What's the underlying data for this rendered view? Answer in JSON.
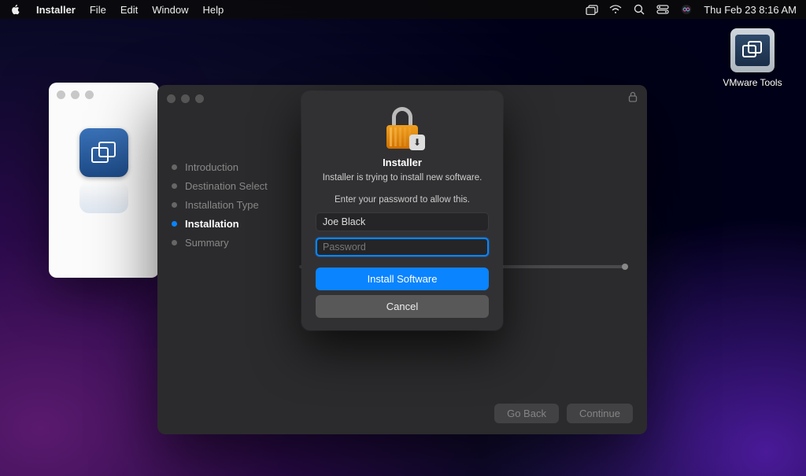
{
  "menubar": {
    "app": "Installer",
    "items": [
      "File",
      "Edit",
      "Window",
      "Help"
    ],
    "clock": "Thu Feb 23  8:16 AM"
  },
  "desktop": {
    "vmware_tools_label": "VMware Tools"
  },
  "installer": {
    "steps": {
      "introduction": "Introduction",
      "destination": "Destination Select",
      "type": "Installation Type",
      "installation": "Installation",
      "summary": "Summary"
    },
    "active_step": "installation",
    "buttons": {
      "go_back": "Go Back",
      "continue": "Continue"
    }
  },
  "auth": {
    "title": "Installer",
    "message": "Installer is trying to install new software.",
    "prompt": "Enter your password to allow this.",
    "username_value": "Joe Black",
    "password_placeholder": "Password",
    "install_label": "Install Software",
    "cancel_label": "Cancel"
  }
}
